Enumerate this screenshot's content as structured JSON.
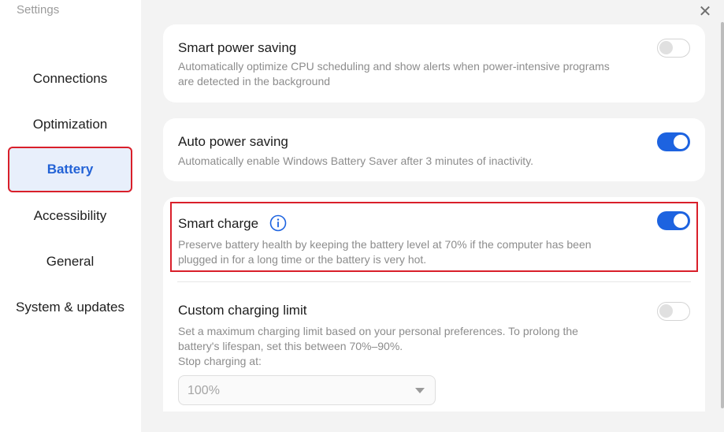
{
  "app": {
    "title": "Settings",
    "close_glyph": "✕"
  },
  "sidebar": {
    "items": [
      {
        "label": "Connections",
        "active": false
      },
      {
        "label": "Optimization",
        "active": false
      },
      {
        "label": "Battery",
        "active": true
      },
      {
        "label": "Accessibility",
        "active": false
      },
      {
        "label": "General",
        "active": false
      },
      {
        "label": "System & updates",
        "active": false
      }
    ]
  },
  "settings": {
    "smart_power_saving": {
      "title": "Smart power saving",
      "description": "Automatically optimize CPU scheduling and show alerts when power-intensive programs are detected in the background",
      "enabled": false
    },
    "auto_power_saving": {
      "title": "Auto power saving",
      "description": "Automatically enable Windows Battery Saver after 3 minutes of inactivity.",
      "enabled": true
    },
    "smart_charge": {
      "title": "Smart charge",
      "description": "Preserve battery health by keeping the battery level at 70% if the computer has been plugged in for a long time or the battery is very hot.",
      "enabled": true,
      "info_icon": "info-icon"
    },
    "custom_charging_limit": {
      "title": "Custom charging limit",
      "description": "Set a maximum charging limit based on your personal preferences. To prolong the battery's lifespan, set this between 70%–90%.",
      "stop_label": "Stop charging at:",
      "selected_value": "100%",
      "enabled": false
    }
  },
  "colors": {
    "accent": "#1d63e0",
    "active_nav_text": "#2262d6",
    "highlight_border": "#d91f2a"
  }
}
